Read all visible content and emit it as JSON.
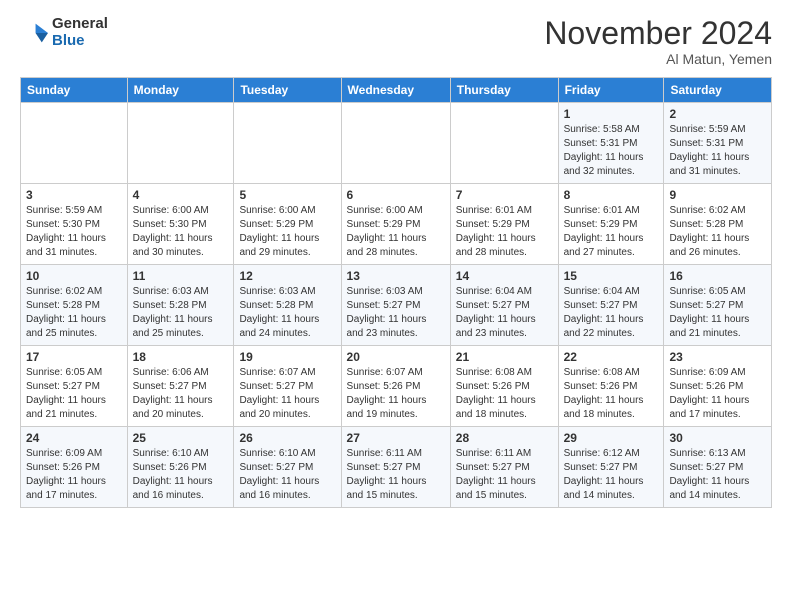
{
  "header": {
    "logo_general": "General",
    "logo_blue": "Blue",
    "month_title": "November 2024",
    "location": "Al Matun, Yemen"
  },
  "weekdays": [
    "Sunday",
    "Monday",
    "Tuesday",
    "Wednesday",
    "Thursday",
    "Friday",
    "Saturday"
  ],
  "weeks": [
    [
      {
        "day": "",
        "info": ""
      },
      {
        "day": "",
        "info": ""
      },
      {
        "day": "",
        "info": ""
      },
      {
        "day": "",
        "info": ""
      },
      {
        "day": "",
        "info": ""
      },
      {
        "day": "1",
        "info": "Sunrise: 5:58 AM\nSunset: 5:31 PM\nDaylight: 11 hours and 32 minutes."
      },
      {
        "day": "2",
        "info": "Sunrise: 5:59 AM\nSunset: 5:31 PM\nDaylight: 11 hours and 31 minutes."
      }
    ],
    [
      {
        "day": "3",
        "info": "Sunrise: 5:59 AM\nSunset: 5:30 PM\nDaylight: 11 hours and 31 minutes."
      },
      {
        "day": "4",
        "info": "Sunrise: 6:00 AM\nSunset: 5:30 PM\nDaylight: 11 hours and 30 minutes."
      },
      {
        "day": "5",
        "info": "Sunrise: 6:00 AM\nSunset: 5:29 PM\nDaylight: 11 hours and 29 minutes."
      },
      {
        "day": "6",
        "info": "Sunrise: 6:00 AM\nSunset: 5:29 PM\nDaylight: 11 hours and 28 minutes."
      },
      {
        "day": "7",
        "info": "Sunrise: 6:01 AM\nSunset: 5:29 PM\nDaylight: 11 hours and 28 minutes."
      },
      {
        "day": "8",
        "info": "Sunrise: 6:01 AM\nSunset: 5:29 PM\nDaylight: 11 hours and 27 minutes."
      },
      {
        "day": "9",
        "info": "Sunrise: 6:02 AM\nSunset: 5:28 PM\nDaylight: 11 hours and 26 minutes."
      }
    ],
    [
      {
        "day": "10",
        "info": "Sunrise: 6:02 AM\nSunset: 5:28 PM\nDaylight: 11 hours and 25 minutes."
      },
      {
        "day": "11",
        "info": "Sunrise: 6:03 AM\nSunset: 5:28 PM\nDaylight: 11 hours and 25 minutes."
      },
      {
        "day": "12",
        "info": "Sunrise: 6:03 AM\nSunset: 5:28 PM\nDaylight: 11 hours and 24 minutes."
      },
      {
        "day": "13",
        "info": "Sunrise: 6:03 AM\nSunset: 5:27 PM\nDaylight: 11 hours and 23 minutes."
      },
      {
        "day": "14",
        "info": "Sunrise: 6:04 AM\nSunset: 5:27 PM\nDaylight: 11 hours and 23 minutes."
      },
      {
        "day": "15",
        "info": "Sunrise: 6:04 AM\nSunset: 5:27 PM\nDaylight: 11 hours and 22 minutes."
      },
      {
        "day": "16",
        "info": "Sunrise: 6:05 AM\nSunset: 5:27 PM\nDaylight: 11 hours and 21 minutes."
      }
    ],
    [
      {
        "day": "17",
        "info": "Sunrise: 6:05 AM\nSunset: 5:27 PM\nDaylight: 11 hours and 21 minutes."
      },
      {
        "day": "18",
        "info": "Sunrise: 6:06 AM\nSunset: 5:27 PM\nDaylight: 11 hours and 20 minutes."
      },
      {
        "day": "19",
        "info": "Sunrise: 6:07 AM\nSunset: 5:27 PM\nDaylight: 11 hours and 20 minutes."
      },
      {
        "day": "20",
        "info": "Sunrise: 6:07 AM\nSunset: 5:26 PM\nDaylight: 11 hours and 19 minutes."
      },
      {
        "day": "21",
        "info": "Sunrise: 6:08 AM\nSunset: 5:26 PM\nDaylight: 11 hours and 18 minutes."
      },
      {
        "day": "22",
        "info": "Sunrise: 6:08 AM\nSunset: 5:26 PM\nDaylight: 11 hours and 18 minutes."
      },
      {
        "day": "23",
        "info": "Sunrise: 6:09 AM\nSunset: 5:26 PM\nDaylight: 11 hours and 17 minutes."
      }
    ],
    [
      {
        "day": "24",
        "info": "Sunrise: 6:09 AM\nSunset: 5:26 PM\nDaylight: 11 hours and 17 minutes."
      },
      {
        "day": "25",
        "info": "Sunrise: 6:10 AM\nSunset: 5:26 PM\nDaylight: 11 hours and 16 minutes."
      },
      {
        "day": "26",
        "info": "Sunrise: 6:10 AM\nSunset: 5:27 PM\nDaylight: 11 hours and 16 minutes."
      },
      {
        "day": "27",
        "info": "Sunrise: 6:11 AM\nSunset: 5:27 PM\nDaylight: 11 hours and 15 minutes."
      },
      {
        "day": "28",
        "info": "Sunrise: 6:11 AM\nSunset: 5:27 PM\nDaylight: 11 hours and 15 minutes."
      },
      {
        "day": "29",
        "info": "Sunrise: 6:12 AM\nSunset: 5:27 PM\nDaylight: 11 hours and 14 minutes."
      },
      {
        "day": "30",
        "info": "Sunrise: 6:13 AM\nSunset: 5:27 PM\nDaylight: 11 hours and 14 minutes."
      }
    ]
  ]
}
